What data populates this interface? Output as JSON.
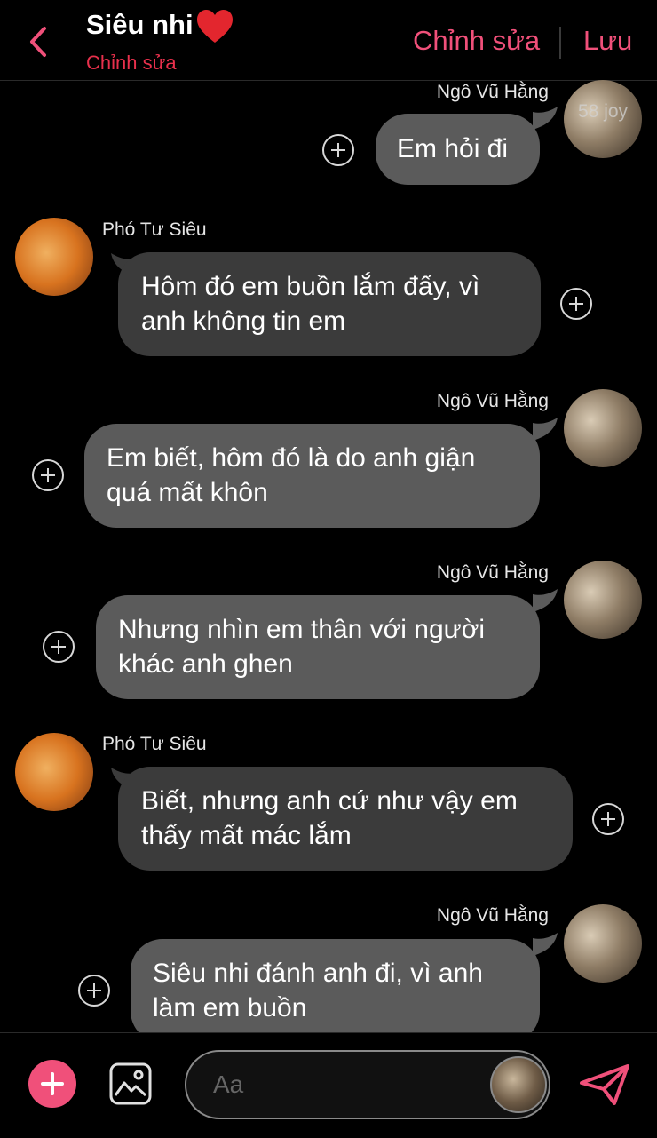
{
  "header": {
    "title": "Siêu nhi",
    "subtitle": "Chỉnh sửa",
    "edit_label": "Chỉnh sửa",
    "save_label": "Lưu",
    "accent_color": "#f0507a",
    "back_icon": "chevron-left-icon",
    "title_emoji": "heart-icon"
  },
  "watermark": "58 joy",
  "messages": [
    {
      "sender": "Ngô Vũ Hằng",
      "text": "Em hỏi đi",
      "side": "right"
    },
    {
      "sender": "Phó Tư Siêu",
      "text": "Hôm đó em buồn lắm đấy, vì anh không tin em",
      "side": "left"
    },
    {
      "sender": "Ngô Vũ Hằng",
      "text": "Em biết, hôm đó là do anh giận quá mất khôn",
      "side": "right"
    },
    {
      "sender": "Ngô Vũ Hằng",
      "text": "Nhưng nhìn em thân với người khác anh ghen",
      "side": "right"
    },
    {
      "sender": "Phó Tư Siêu",
      "text": "Biết, nhưng anh cứ như vậy em thấy mất mác lắm",
      "side": "left"
    },
    {
      "sender": "Ngô Vũ Hằng",
      "text": "Siêu nhi đánh anh đi, vì anh làm em buồn",
      "side": "right"
    }
  ],
  "composer": {
    "placeholder": "Aa",
    "add_icon": "plus-circle-icon",
    "image_icon": "image-icon",
    "send_icon": "send-icon"
  }
}
